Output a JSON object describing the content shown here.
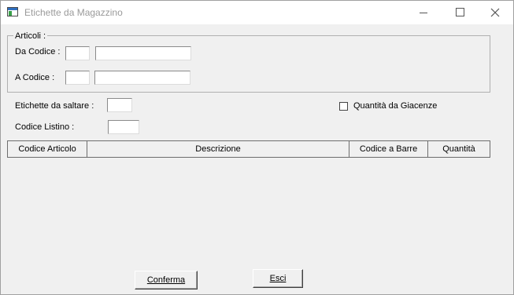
{
  "window": {
    "title": "Etichette da Magazzino",
    "controls": [
      "minimize-icon",
      "maximize-icon",
      "close-icon"
    ]
  },
  "articoli": {
    "legend": "Articoli :",
    "da_codice_label": "Da Codice :",
    "a_codice_label": "A  Codice :",
    "da_codice_prefix": "",
    "da_codice_value": "",
    "a_codice_prefix": "",
    "a_codice_value": ""
  },
  "options": {
    "etichette_label": "Etichette da saltare :",
    "etichette_value": "",
    "codice_listino_label": "Codice Listino :",
    "codice_listino_value": "",
    "quantita_giacenze_label": "Quantità da Giacenze",
    "quantita_giacenze_checked": false
  },
  "table": {
    "columns": [
      "Codice Articolo",
      "Descrizione",
      "Codice a Barre",
      "Quantità"
    ],
    "rows": []
  },
  "buttons": {
    "confirm": "Conferma",
    "exit": "Esci"
  }
}
